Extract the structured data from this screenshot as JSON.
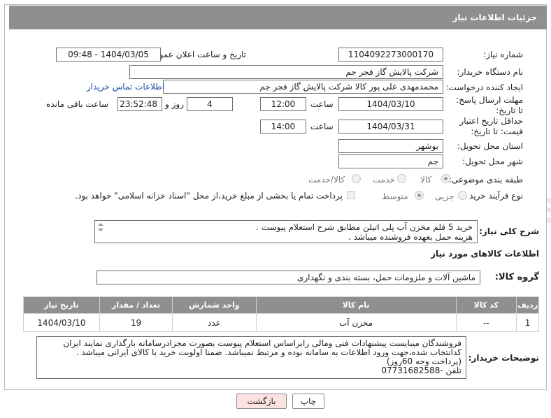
{
  "header": {
    "title": "جزئیات اطلاعات نیاز"
  },
  "form": {
    "need_number": {
      "label": "شماره نیاز:",
      "value": "1104092273000170"
    },
    "announce": {
      "label": "تاریخ و ساعت اعلان عمومی:",
      "value": "1404/03/05 - 09:48"
    },
    "buyer_org": {
      "label": "نام دستگاه خریدار:",
      "value": "شرکت پالایش گاز فجر جم"
    },
    "requester": {
      "label": "ایجاد کننده درخواست:",
      "value": "محمدمهدی علی پور کالا شرکت پالایش گاز فجر جم",
      "contact_link": "اطلاعات تماس خریدار"
    },
    "reply_deadline": {
      "label": "مهلت ارسال پاسخ: تا تاریخ:",
      "date": "1404/03/10",
      "time_label": "ساعت",
      "time": "12:00",
      "days": "4",
      "days_label": "روز و",
      "remaining": "23:52:48",
      "remaining_label": "ساعت باقی مانده"
    },
    "price_validity": {
      "label": "حداقل تاریخ اعتبار قیمت: تا تاریخ:",
      "date": "1404/03/31",
      "time_label": "ساعت",
      "time": "14:00"
    },
    "province": {
      "label": "استان محل تحویل:",
      "value": "بوشهر"
    },
    "city": {
      "label": "شهر محل تحویل:",
      "value": "جم"
    },
    "category": {
      "label": "طبقه بندی موضوعی:",
      "options": [
        "کالا",
        "خدمت",
        "کالا/خدمت"
      ],
      "selected": 0
    },
    "purchase_type": {
      "label": "نوع فرآیند خرید :",
      "options": [
        "جزیی",
        "متوسط"
      ],
      "selected": 1,
      "note": "پرداخت تمام یا بخشی از مبلغ خرید،از محل \"اسناد خزانه اسلامی\" خواهد بود."
    }
  },
  "description": {
    "label": "شرح کلی نیاز:",
    "line1": "خرید 5 قلم مخزن آب پلی اتیلن مطابق شرح استعلام پیوست .",
    "line2": "هزینه حمل بعهده فروشنده میباشد ."
  },
  "goods": {
    "section_title": "اطلاعات کالاهای مورد نیاز",
    "group_label": "گروه کالا:",
    "group_value": "ماشین آلات و ملزومات حمل، بسته بندی و نگهداری",
    "columns": [
      "ردیف",
      "کد کالا",
      "نام کالا",
      "واحد شمارش",
      "تعداد / مقدار",
      "تاریخ نیاز"
    ],
    "rows": [
      [
        "1",
        "--",
        "مخزن آب",
        "عدد",
        "19",
        "1404/03/10"
      ]
    ]
  },
  "buyer_notes": {
    "label": "توضیحات خریدار:",
    "lines": [
      "فروشندگان میبایست پیشنهادات فنی ومالی رابراساس استعلام پیوست بصورت مجزادرسامانه بارگذاری نمایند ایران",
      "کدانتخاب شده،جهت ورود اطلاعات به سامانه بوده و مرتبط نمیباشد. ضمنا اولویت خرید با کالای ایرانی میباشد .",
      "(پرداخت وجه 60روز)",
      "تلفن -07731682588"
    ]
  },
  "buttons": {
    "print": "چاپ",
    "back": "بازگشت"
  },
  "watermark": {
    "text": "AriaTender.neT"
  },
  "colors": {
    "header_bg": "#8f8f8f",
    "link": "#1a4aa6",
    "back_button_bg": "#fde2e2"
  }
}
